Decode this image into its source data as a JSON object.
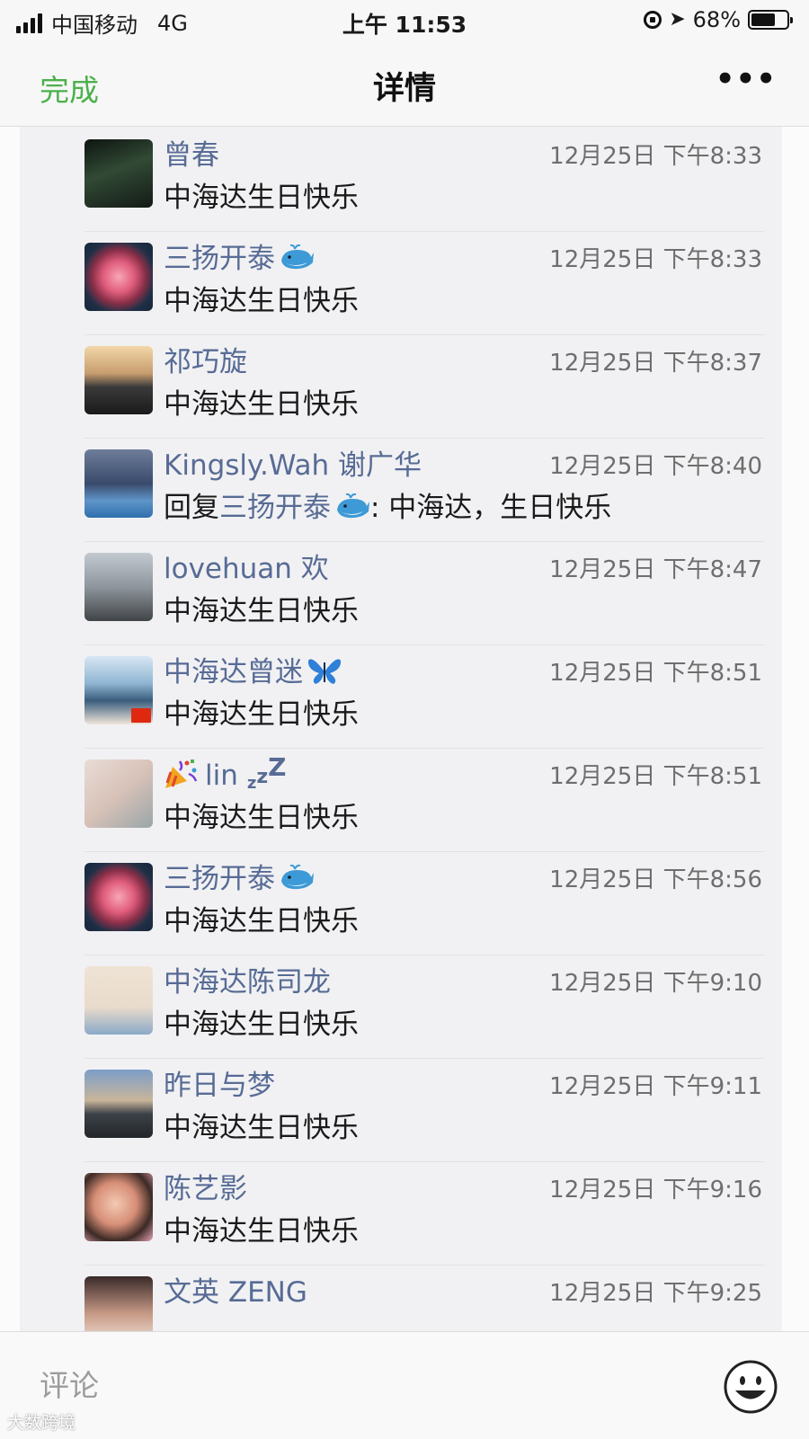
{
  "status_bar": {
    "carrier": "中国移动",
    "network": "4G",
    "time": "上午 11:53",
    "battery": "68%",
    "battery_level": 0.68
  },
  "nav": {
    "done_label": "完成",
    "title": "详情",
    "more_label": "•••"
  },
  "comments": [
    {
      "name": "曾春",
      "time": "12月25日 下午8:33",
      "text": "中海达生日快乐",
      "avatar": "car-photo"
    },
    {
      "name": "三扬开泰",
      "name_icon": "whale-icon",
      "time": "12月25日 下午8:33",
      "text": "中海达生日快乐",
      "avatar": "rose-photo"
    },
    {
      "name": "祁巧旋",
      "time": "12月25日 下午8:37",
      "text": "中海达生日快乐",
      "avatar": "lake-photo"
    },
    {
      "name": "Kingsly.Wah 谢广华",
      "time": "12月25日 下午8:40",
      "reply_prefix": "回复",
      "reply_to": "三扬开泰",
      "reply_to_icon": "whale-icon",
      "text": ": 中海达，生日快乐",
      "avatar": "crowd-photo"
    },
    {
      "name": "lovehuan 欢",
      "time": "12月25日 下午8:47",
      "text": "中海达生日快乐",
      "avatar": "girl-photo"
    },
    {
      "name": "中海达曾迷",
      "name_icon": "butterfly-icon",
      "time": "12月25日 下午8:51",
      "text": "中海达生日快乐",
      "avatar": "woman-photo"
    },
    {
      "name": "lin",
      "name_prefix_icon": "party-popper-icon",
      "name_suffix_icon": "zzz-icon",
      "time": "12月25日 下午8:51",
      "text": "中海达生日快乐",
      "avatar": "hands-photo"
    },
    {
      "name": "三扬开泰",
      "name_icon": "whale-icon",
      "time": "12月25日 下午8:56",
      "text": "中海达生日快乐",
      "avatar": "rose-photo"
    },
    {
      "name": "中海达陈司龙",
      "time": "12月25日 下午9:10",
      "text": "中海达生日快乐",
      "avatar": "boy-illustration"
    },
    {
      "name": "昨日与梦",
      "time": "12月25日 下午9:11",
      "text": "中海达生日快乐",
      "avatar": "sunset-photo"
    },
    {
      "name": "陈艺影",
      "time": "12月25日 下午9:16",
      "text": "中海达生日快乐",
      "avatar": "selfie-photo"
    },
    {
      "name": "文英 ZENG",
      "time": "12月25日 下午9:25",
      "text": "",
      "avatar": "woman-portrait-photo"
    }
  ],
  "comment_bar": {
    "placeholder": "评论",
    "watermark": "大数跨境"
  }
}
